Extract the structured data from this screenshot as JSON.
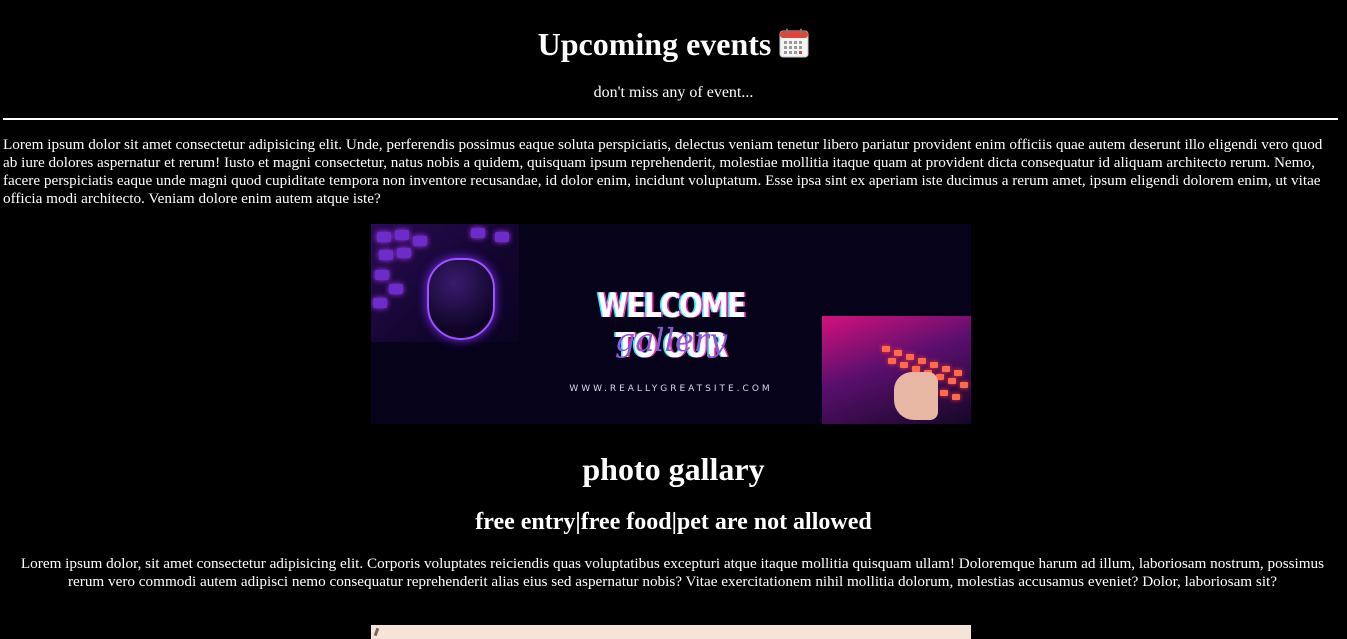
{
  "header": {
    "title": "Upcoming events",
    "title_icon": "calendar-icon",
    "subtitle": "don't miss any of event..."
  },
  "intro_text": "Lorem ipsum dolor sit amet consectetur adipisicing elit. Unde, perferendis possimus eaque soluta perspiciatis, delectus veniam tenetur libero pariatur provident enim officiis quae autem deserunt illo eligendi vero quod ab iure dolores aspernatur et rerum! Iusto et magni consectetur, natus nobis a quidem, quisquam ipsum reprehenderit, molestiae mollitia itaque quam at provident dicta consequatur id aliquam architecto rerum. Nemo, facere perspiciatis eaque unde magni quod cupiditate tempora non inventore recusandae, id dolor enim, incidunt voluptatum. Esse ipsa sint ex aperiam iste ducimus a rerum amet, ipsum eligendi dolorem enim, ut vitae officia modi architecto. Veniam dolore enim autem atque iste?",
  "banner": {
    "heading": "WELCOME TO OUR",
    "script": "gallery",
    "url": "WWW.REALLYGREATSITE.COM",
    "colors": {
      "background": "#06021a",
      "accent_pink": "#ff2aa8",
      "accent_cyan": "#30e6ff",
      "accent_purple": "#8a5ad6"
    }
  },
  "gallery": {
    "title": "photo gallary",
    "info": "free entry|free food|pet are not allowed",
    "text": "Lorem ipsum dolor, sit amet consectetur adipisicing elit. Corporis voluptates reiciendis quas voluptatibus excepturi atque itaque mollitia quisquam ullam! Doloremque harum ad illum, laboriosam nostrum, possimus rerum vero commodi autem adipisci nemo consequatur reprehenderit alias eius sed aspernatur nobis? Vitae exercitationem nihil mollitia dolorum, molestias accusamus eveniet? Dolor, laboriosam sit?"
  },
  "theme": {
    "background": "#000000",
    "text": "#ffffff"
  }
}
